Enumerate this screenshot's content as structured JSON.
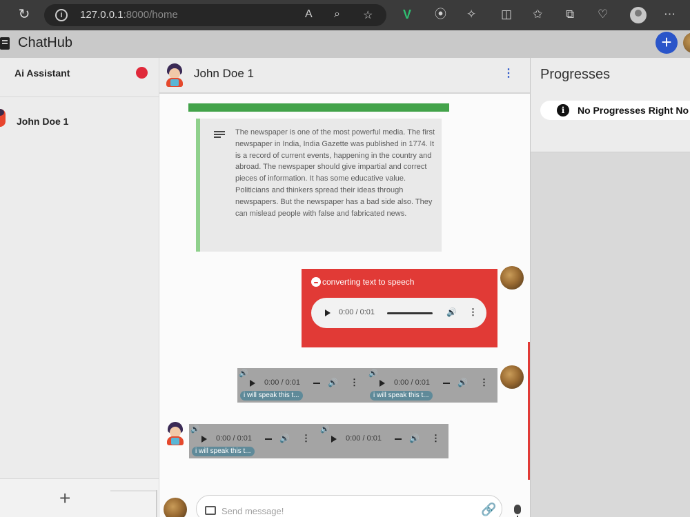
{
  "browser": {
    "url_host": "127.0.0.1",
    "url_path": ":8000/home"
  },
  "app": {
    "title": "ChatHub",
    "add_icon": "plus-icon",
    "brand_color": "#2a55c9"
  },
  "sidebar": {
    "items": [
      {
        "label": "Ai Assistant",
        "status_color": "#e0293a"
      },
      {
        "label": "John Doe 1"
      }
    ],
    "add_icon": "plus-icon"
  },
  "chat": {
    "contact_name": "John Doe 1",
    "text_message": "The newspaper is one of the most powerful media. The first newspaper in India, India Gazette was published in 1774. It is a record of current events, happening in the country and abroad. The newspaper should give impartial and correct pieces of information. It has some educative value. Politicians and thinkers spread their ideas through newspapers. But the newspaper has a bad side also. They can mislead people with false and fabricated news.",
    "tts_status": "converting text to speech",
    "tts_player": {
      "time": "0:00 / 0:01"
    },
    "sent_audio": [
      {
        "time": "0:00 / 0:01",
        "caption": "i will speak this t..."
      },
      {
        "time": "0:00 / 0:01",
        "caption": "i will speak this t..."
      }
    ],
    "received_audio": [
      {
        "time": "0:00 / 0:01",
        "caption": "i will speak this t..."
      },
      {
        "time": "0:00 / 0:01",
        "caption": ""
      }
    ],
    "composer": {
      "placeholder": "Send message!"
    }
  },
  "progress_panel": {
    "title": "Progresses",
    "empty_message": "No Progresses Right No"
  }
}
